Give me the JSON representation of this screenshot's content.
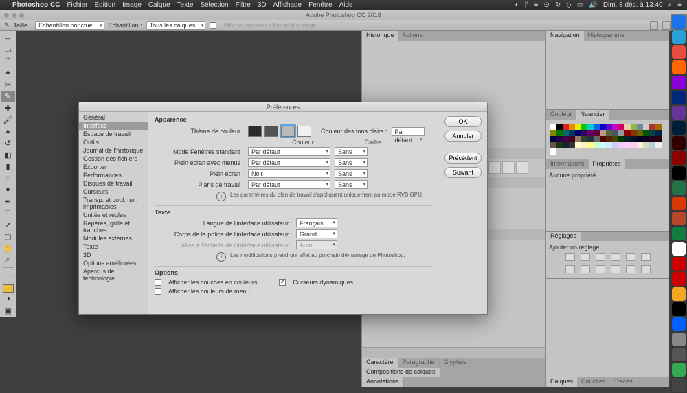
{
  "mac_menu": {
    "app": "Photoshop CC",
    "items": [
      "Fichier",
      "Edition",
      "Image",
      "Calque",
      "Texte",
      "Sélection",
      "Filtre",
      "3D",
      "Affichage",
      "Fenêtre",
      "Aide"
    ],
    "clock": "Dim. 8 déc. à 13:40"
  },
  "titlebar": "Adobe Photoshop CC 2018",
  "optbar": {
    "taille": "Taille :",
    "taille_val": "Echantillon ponctuel",
    "echan": "Echantillon :",
    "echan_val": "Tous les calques",
    "ghost": "Afficher anneau d'échantillonnage"
  },
  "panels": {
    "nav": "Navigation",
    "histo": "Histogramme",
    "couleur": "Couleur",
    "nuancier": "Nuancier",
    "info": "Informations",
    "props": "Propriétés",
    "noprop": "Aucune propriété",
    "reglages": "Réglages",
    "ajouter": "Ajouter un réglage",
    "calques": "Calques",
    "couches": "Couches",
    "traces": "Tracés",
    "historique": "Historique",
    "actions": "Actions",
    "caractere": "Caractère",
    "paragraphe": "Paragraphe",
    "glyphes": "Glyphes",
    "compo": "Compositions de calques",
    "annot": "Annotations"
  },
  "swatch_colors": [
    "#fff",
    "#000",
    "#d22",
    "#e80",
    "#ee0",
    "#0c0",
    "#0cc",
    "#06e",
    "#00c",
    "#60c",
    "#c0c",
    "#c06",
    "#eca",
    "#8b4",
    "#789",
    "#ccc",
    "#a33",
    "#a60",
    "#880",
    "#070",
    "#066",
    "#036",
    "#006",
    "#306",
    "#606",
    "#603",
    "#b98",
    "#563",
    "#456",
    "#999",
    "#800",
    "#830",
    "#660",
    "#050",
    "#044",
    "#024",
    "#004",
    "#204",
    "#404",
    "#402",
    "#976",
    "#342",
    "#234",
    "#666",
    "#500",
    "#520",
    "#440",
    "#030",
    "#022",
    "#012",
    "#002",
    "#102",
    "#202",
    "#201",
    "#654",
    "#231",
    "#123",
    "#333",
    "#ffc",
    "#fec",
    "#ff8",
    "#cfc",
    "#cff",
    "#cef",
    "#ccf",
    "#ecf",
    "#fcf",
    "#fce",
    "#fed",
    "#cdb",
    "#bcd",
    "#eee",
    "#fff"
  ],
  "dlg": {
    "title": "Préférences",
    "side": [
      "Général",
      "Interface",
      "Espace de travail",
      "Outils",
      "Journal de l'historique",
      "Gestion des fichiers",
      "Exporter",
      "Performances",
      "Disques de travail",
      "Curseurs",
      "Transp. et coul. non imprimables",
      "Unités et règles",
      "Repères, grille et tranches",
      "Modules externes",
      "Texte",
      "3D",
      "Options améliorées",
      "Aperçus de technologie"
    ],
    "side_active": 1,
    "btns": {
      "ok": "OK",
      "annuler": "Annuler",
      "prec": "Précédent",
      "suiv": "Suivant"
    },
    "apparence": "Apparence",
    "theme": "Thème de couleur :",
    "tons": "Couleur des tons clairs :",
    "tons_val": "Par défaut",
    "col_h1": "Couleur",
    "col_h2": "Cadre",
    "rows": [
      {
        "label": "Mode Fenêtres standard :",
        "v1": "Par défaut",
        "v2": "Sans"
      },
      {
        "label": "Plein écran avec menus :",
        "v1": "Par défaut",
        "v2": "Sans"
      },
      {
        "label": "Plein écran :",
        "v1": "Noir",
        "v2": "Sans"
      },
      {
        "label": "Plans de travail :",
        "v1": "Par défaut",
        "v2": "Sans"
      }
    ],
    "info1": "Les paramètres du plan de travail s'appliquent uniquement au mode RVB GPU.",
    "texte": "Texte",
    "langue_l": "Langue de l'interface utilisateur :",
    "langue_v": "Français",
    "corps_l": "Corps de la police de l'interface utilisateur :",
    "corps_v": "Grand",
    "echelle_l": "Mise à l'échelle de l'interface utilisateur :",
    "echelle_v": "Auto",
    "info2": "Les modifications prendront effet au prochain démarrage de Photoshop.",
    "options": "Options",
    "opt1": "Afficher les couches en couleurs",
    "opt2": "Curseurs dynamiques",
    "opt3": "Afficher les couleurs de menu"
  },
  "dock_colors": [
    "#1a73e8",
    "#2a9fd6",
    "#e74c3c",
    "#ff6600",
    "#8b00d6",
    "#00287a",
    "#663399",
    "#001e36",
    "#310000",
    "#8B0000",
    "#000",
    "#217346",
    "#d83b01",
    "#b7472a",
    "#107c41",
    "#fff",
    "#c00",
    "#c00",
    "#f5a623",
    "#000",
    "#0061fe",
    "#888",
    "#555",
    "#34a853",
    "#444"
  ]
}
